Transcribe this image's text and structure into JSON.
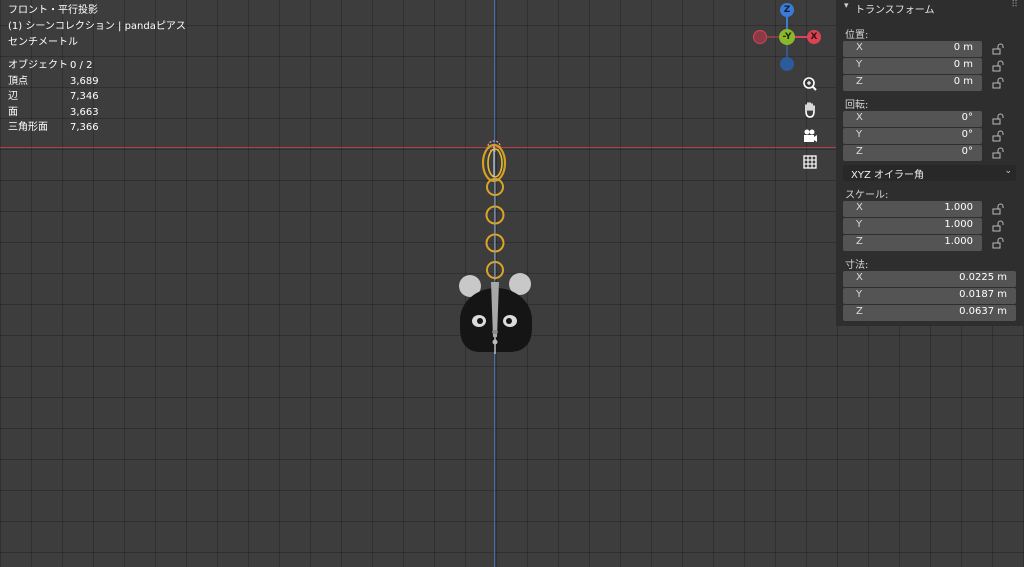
{
  "viewport": {
    "view_name": "フロント・平行投影",
    "collection": "(1) シーンコレクション | pandaピアス",
    "units": "センチメートル",
    "stats": [
      {
        "label": "オブジェクト",
        "value": "0 / 2"
      },
      {
        "label": "頂点",
        "value": "3,689"
      },
      {
        "label": "辺",
        "value": "7,346"
      },
      {
        "label": "面",
        "value": "3,663"
      },
      {
        "label": "三角形面",
        "value": "7,366"
      }
    ]
  },
  "gizmo": {
    "z_label": "Z",
    "y_label": "-Y",
    "x_label": "X",
    "colors": {
      "x": "#d94454",
      "y": "#8ab82a",
      "z": "#3b7bd6"
    }
  },
  "nav_icons": [
    "zoom-icon",
    "hand-pan-icon",
    "camera-icon",
    "grid-icon"
  ],
  "panel": {
    "title": "トランスフォーム",
    "location_label": "位置:",
    "location": [
      {
        "axis": "X",
        "value": "0 m"
      },
      {
        "axis": "Y",
        "value": "0 m"
      },
      {
        "axis": "Z",
        "value": "0 m"
      }
    ],
    "rotation_label": "回転:",
    "rotation": [
      {
        "axis": "X",
        "value": "0°"
      },
      {
        "axis": "Y",
        "value": "0°"
      },
      {
        "axis": "Z",
        "value": "0°"
      }
    ],
    "rotation_mode": "XYZ オイラー角",
    "scale_label": "スケール:",
    "scale": [
      {
        "axis": "X",
        "value": "1.000"
      },
      {
        "axis": "Y",
        "value": "1.000"
      },
      {
        "axis": "Z",
        "value": "1.000"
      }
    ],
    "dimensions_label": "寸法:",
    "dimensions": [
      {
        "axis": "X",
        "value": "0.0225 m"
      },
      {
        "axis": "Y",
        "value": "0.0187 m"
      },
      {
        "axis": "Z",
        "value": "0.0637 m"
      }
    ]
  }
}
